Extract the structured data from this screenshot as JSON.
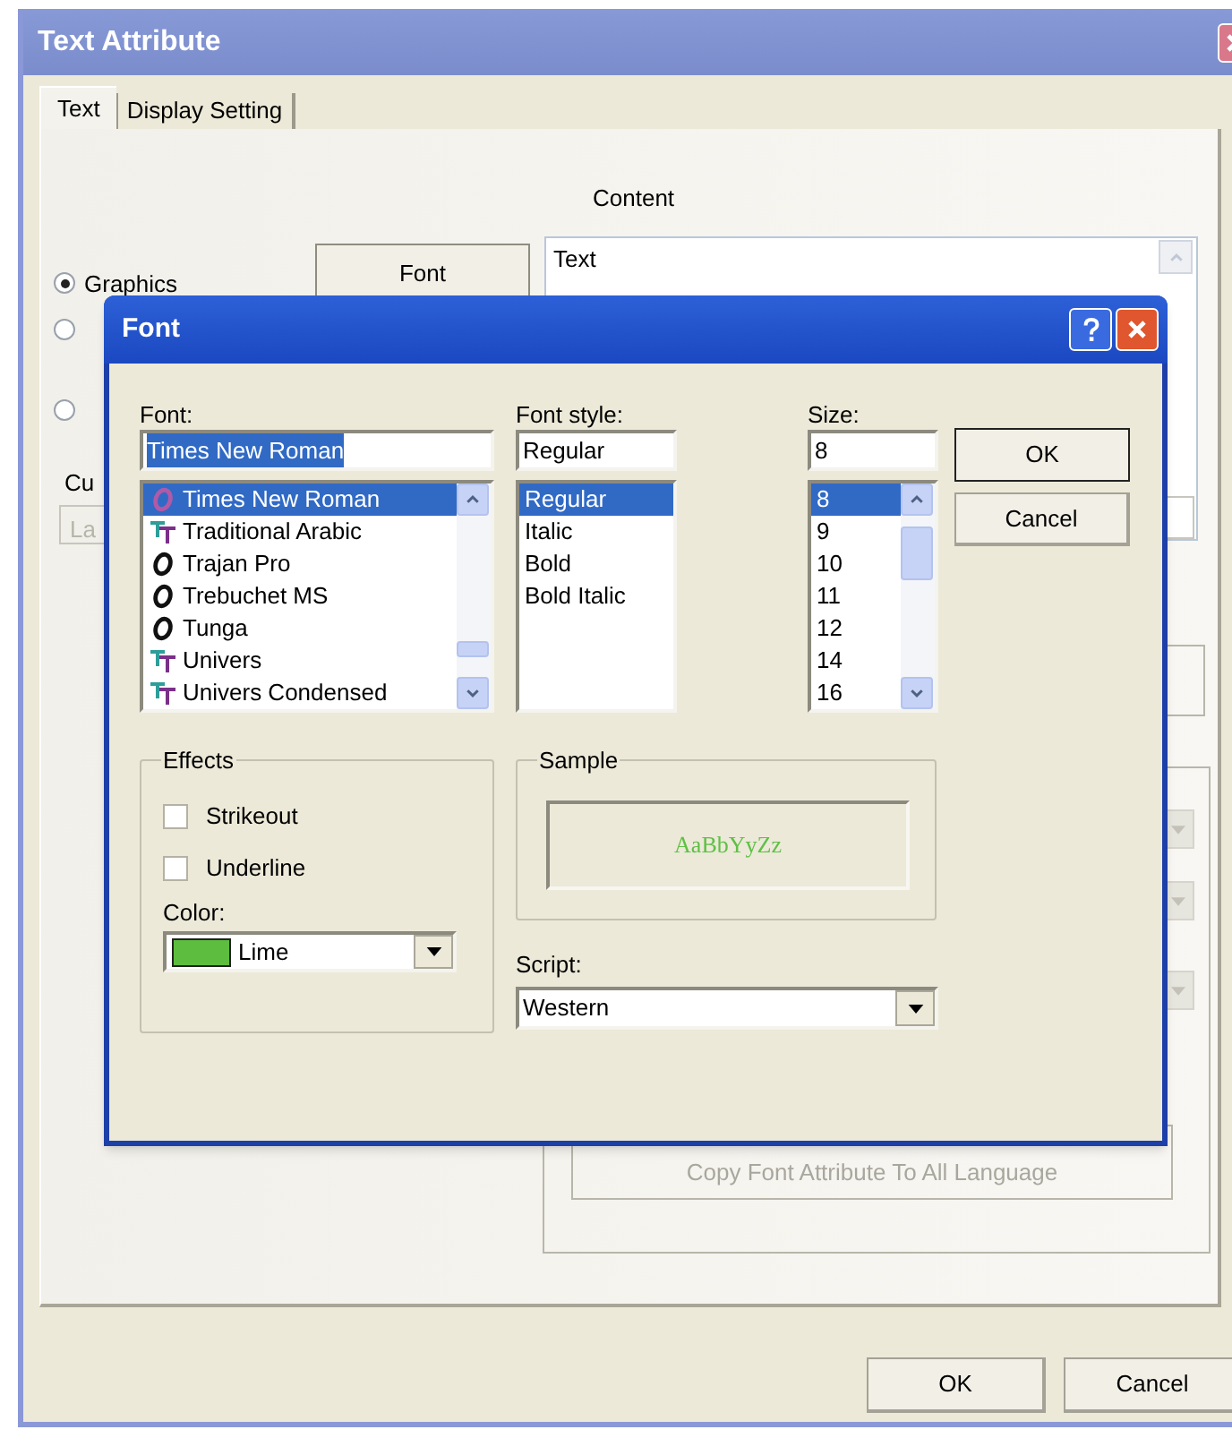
{
  "window": {
    "title": "Text Attribute"
  },
  "tabs": [
    {
      "label": "Text",
      "selected": true
    },
    {
      "label": "Display Setting",
      "selected": false
    }
  ],
  "text_tab": {
    "content_label": "Content",
    "content_value": "Text",
    "options": [
      {
        "label": "Graphics",
        "selected": true
      },
      {
        "selected": false
      },
      {
        "selected": false
      }
    ],
    "font_button": "Font",
    "label_cut": "Cu",
    "cut_button": {
      "label": "La",
      "disabled": true
    },
    "display_combos": [
      {
        "disabled": true
      },
      {
        "disabled": true
      },
      {
        "disabled": true
      }
    ],
    "copy_button": {
      "label": "Copy Font Attribute To All Language",
      "disabled": true
    }
  },
  "buttons": [
    "OK",
    "Cancel"
  ],
  "font_dialog": {
    "title": "Font",
    "font_label": "Font:",
    "font_value": "Times New Roman",
    "font_value_highlighted": true,
    "fonts": [
      {
        "name": "Times New Roman",
        "kind": "opentype",
        "selected": true
      },
      {
        "name": "Traditional Arabic",
        "kind": "truetype",
        "selected": false
      },
      {
        "name": "Trajan Pro",
        "kind": "opentype",
        "selected": false
      },
      {
        "name": "Trebuchet MS",
        "kind": "opentype",
        "selected": false
      },
      {
        "name": "Tunga",
        "kind": "opentype",
        "selected": false
      },
      {
        "name": "Univers",
        "kind": "truetype",
        "selected": false
      },
      {
        "name": "Univers Condensed",
        "kind": "truetype",
        "selected": false
      }
    ],
    "style_label": "Font style:",
    "style_value": "Regular",
    "styles": [
      {
        "name": "Regular",
        "selected": true
      },
      {
        "name": "Italic",
        "selected": false
      },
      {
        "name": "Bold",
        "selected": false
      },
      {
        "name": "Bold Italic",
        "selected": false
      }
    ],
    "size_label": "Size:",
    "size_value": "8",
    "sizes": [
      {
        "name": "8",
        "selected": true
      },
      {
        "name": "9",
        "selected": false
      },
      {
        "name": "10",
        "selected": false
      },
      {
        "name": "11",
        "selected": false
      },
      {
        "name": "12",
        "selected": false
      },
      {
        "name": "14",
        "selected": false
      },
      {
        "name": "16",
        "selected": false
      }
    ],
    "ok": "OK",
    "cancel": "Cancel",
    "effects_title": "Effects",
    "effects": [
      {
        "label": "Strikeout",
        "checked": false
      },
      {
        "label": "Underline",
        "checked": false
      }
    ],
    "color_label": "Color:",
    "color_value": "Lime",
    "sample_title": "Sample",
    "sample_text": "AaBbYyZz",
    "script_label": "Script:",
    "script_value": "Western"
  }
}
